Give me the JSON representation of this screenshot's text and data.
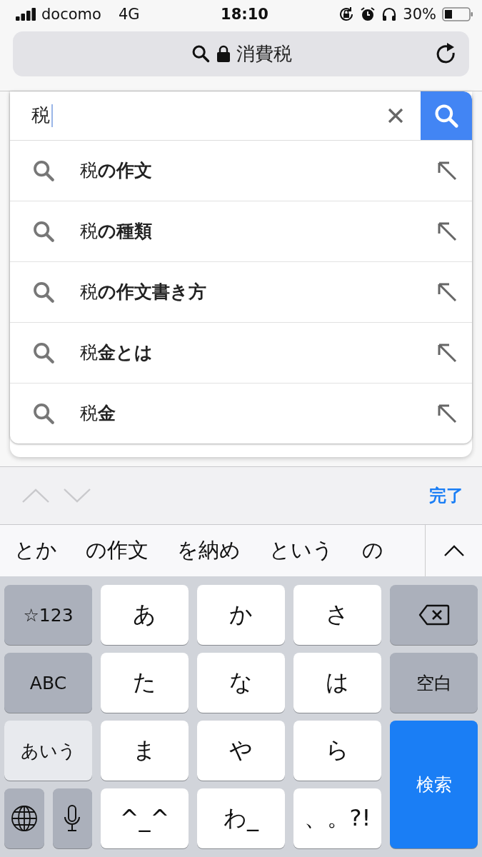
{
  "status_bar": {
    "carrier": "docomo",
    "network": "4G",
    "time": "18:10",
    "battery": "30%"
  },
  "address_bar": {
    "text": "消費税"
  },
  "search": {
    "value": "税"
  },
  "suggestions": [
    {
      "text": "税**の作文**"
    },
    {
      "text": "税**の種類**"
    },
    {
      "text": "税**の作文書き方**"
    },
    {
      "text": "税**金とは**"
    },
    {
      "text": "税**金**"
    }
  ],
  "toolbar": {
    "done": "完了"
  },
  "candidates": [
    "とか",
    "の作文",
    "を納め",
    "という",
    "の"
  ],
  "keyboard": [
    [
      {
        "kind": "function",
        "label": "☆123"
      },
      {
        "kind": "char",
        "label": "あ"
      },
      {
        "kind": "char",
        "label": "か"
      },
      {
        "kind": "char",
        "label": "さ"
      },
      {
        "kind": "delete"
      }
    ],
    [
      {
        "kind": "function",
        "label": "ABC"
      },
      {
        "kind": "char",
        "label": "た"
      },
      {
        "kind": "char",
        "label": "な"
      },
      {
        "kind": "char",
        "label": "は"
      },
      {
        "kind": "function",
        "label": "空白"
      }
    ],
    [
      {
        "kind": "light",
        "label": "あいう"
      },
      {
        "kind": "char",
        "label": "ま"
      },
      {
        "kind": "char",
        "label": "や"
      },
      {
        "kind": "char",
        "label": "ら"
      },
      {
        "kind": "primary",
        "label": "検索"
      }
    ],
    [
      {
        "kind": "split",
        "keys": [
          {
            "kind": "globe"
          },
          {
            "kind": "mic"
          }
        ]
      },
      {
        "kind": "char",
        "label": "^_^"
      },
      {
        "kind": "char",
        "label": "わ_"
      },
      {
        "kind": "char",
        "label": "、。?!"
      }
    ]
  ]
}
